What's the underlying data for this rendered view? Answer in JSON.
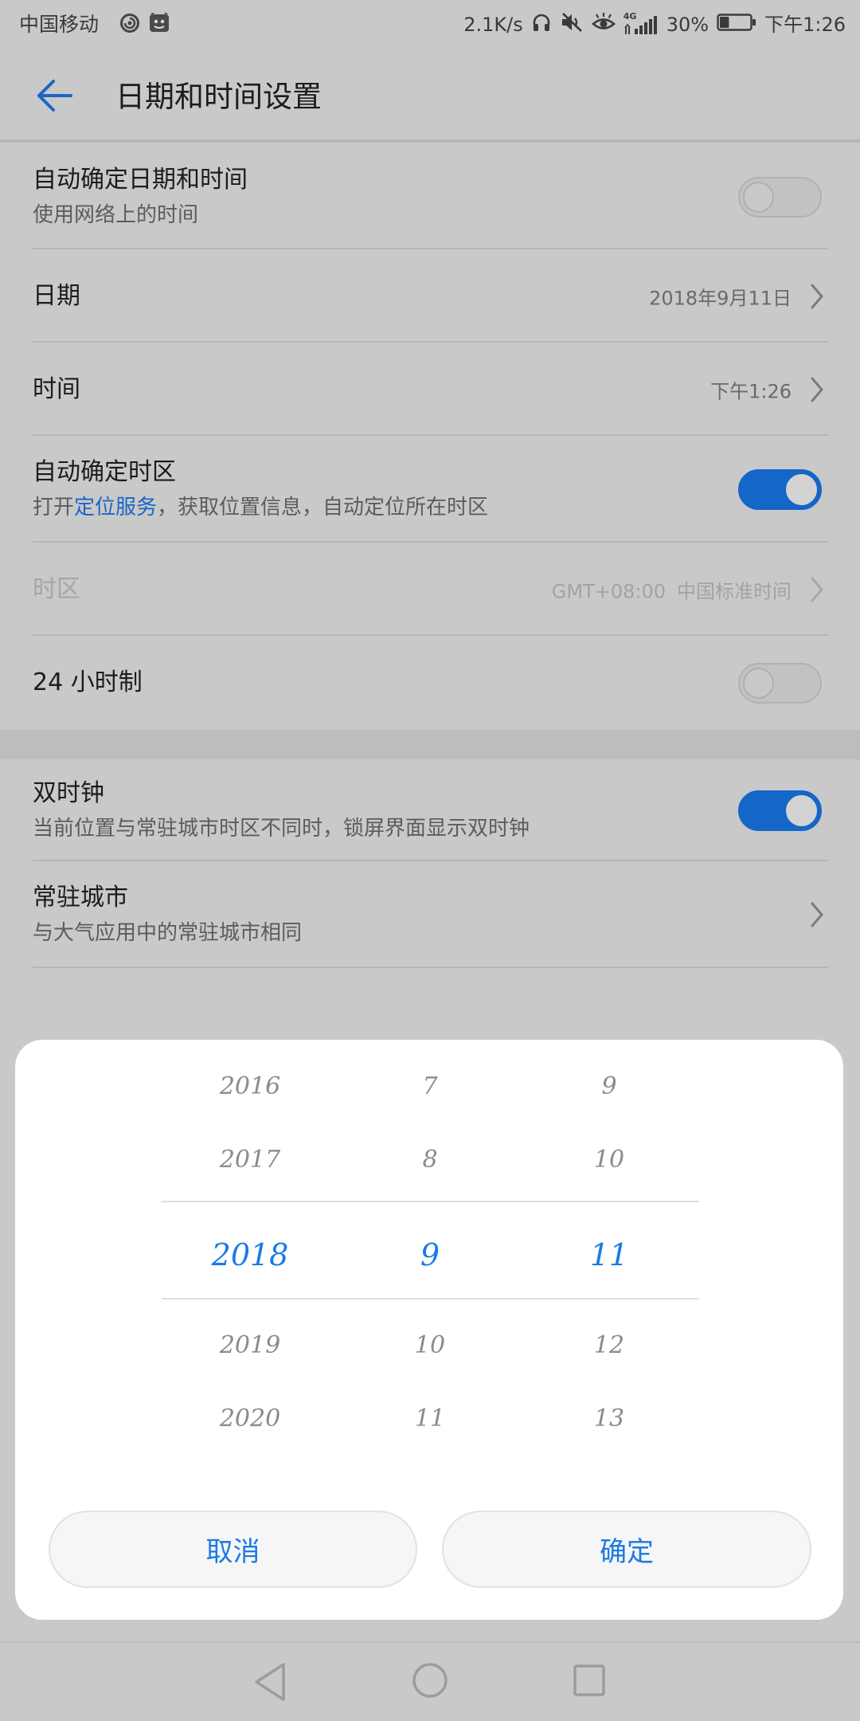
{
  "status_bar": {
    "carrier": "中国移动",
    "left_icons": [
      "swirl-icon",
      "app-badge-icon"
    ],
    "net_speed": "2.1K/s",
    "right_icons": [
      "headphone-icon",
      "mute-icon",
      "eye-comfort-icon",
      "signal-icon",
      "battery-icon"
    ],
    "network_type": "4G",
    "battery_text": "30%",
    "battery_level": 0.3,
    "time": "下午1:26"
  },
  "app_bar": {
    "back_icon": "back-arrow-icon",
    "title": "日期和时间设置"
  },
  "settings": {
    "auto_datetime": {
      "title": "自动确定日期和时间",
      "subtitle": "使用网络上的时间",
      "on": false
    },
    "date": {
      "title": "日期",
      "value": "2018年9月11日"
    },
    "time": {
      "title": "时间",
      "value": "下午1:26"
    },
    "auto_timezone": {
      "title": "自动确定时区",
      "subtitle_prefix": "打开",
      "subtitle_link": "定位服务",
      "subtitle_suffix": "，获取位置信息，自动定位所在时区",
      "on": true
    },
    "timezone": {
      "title": "时区",
      "value_offset": "GMT+08:00",
      "value_name": "中国标准时间",
      "disabled": true
    },
    "hour_24": {
      "title": "24 小时制",
      "on": false
    },
    "dual_clock": {
      "title": "双时钟",
      "subtitle": "当前位置与常驻城市时区不同时，锁屏界面显示双时钟",
      "on": true
    },
    "home_city": {
      "title": "常驻城市",
      "subtitle": "与大气应用中的常驻城市相同"
    }
  },
  "date_picker": {
    "years": [
      "2016",
      "2017",
      "2018",
      "2019",
      "2020"
    ],
    "months": [
      "7",
      "8",
      "9",
      "10",
      "11"
    ],
    "days": [
      "9",
      "10",
      "11",
      "12",
      "13"
    ],
    "selected_index": 2,
    "cancel_label": "取消",
    "confirm_label": "确定"
  },
  "nav_bar": {
    "icons": [
      "nav-back-icon",
      "nav-home-icon",
      "nav-recents-icon"
    ]
  },
  "colors": {
    "accent": "#007dff",
    "toggle_on": "#1466c8",
    "dimmed_background": "#c9c9c9"
  }
}
